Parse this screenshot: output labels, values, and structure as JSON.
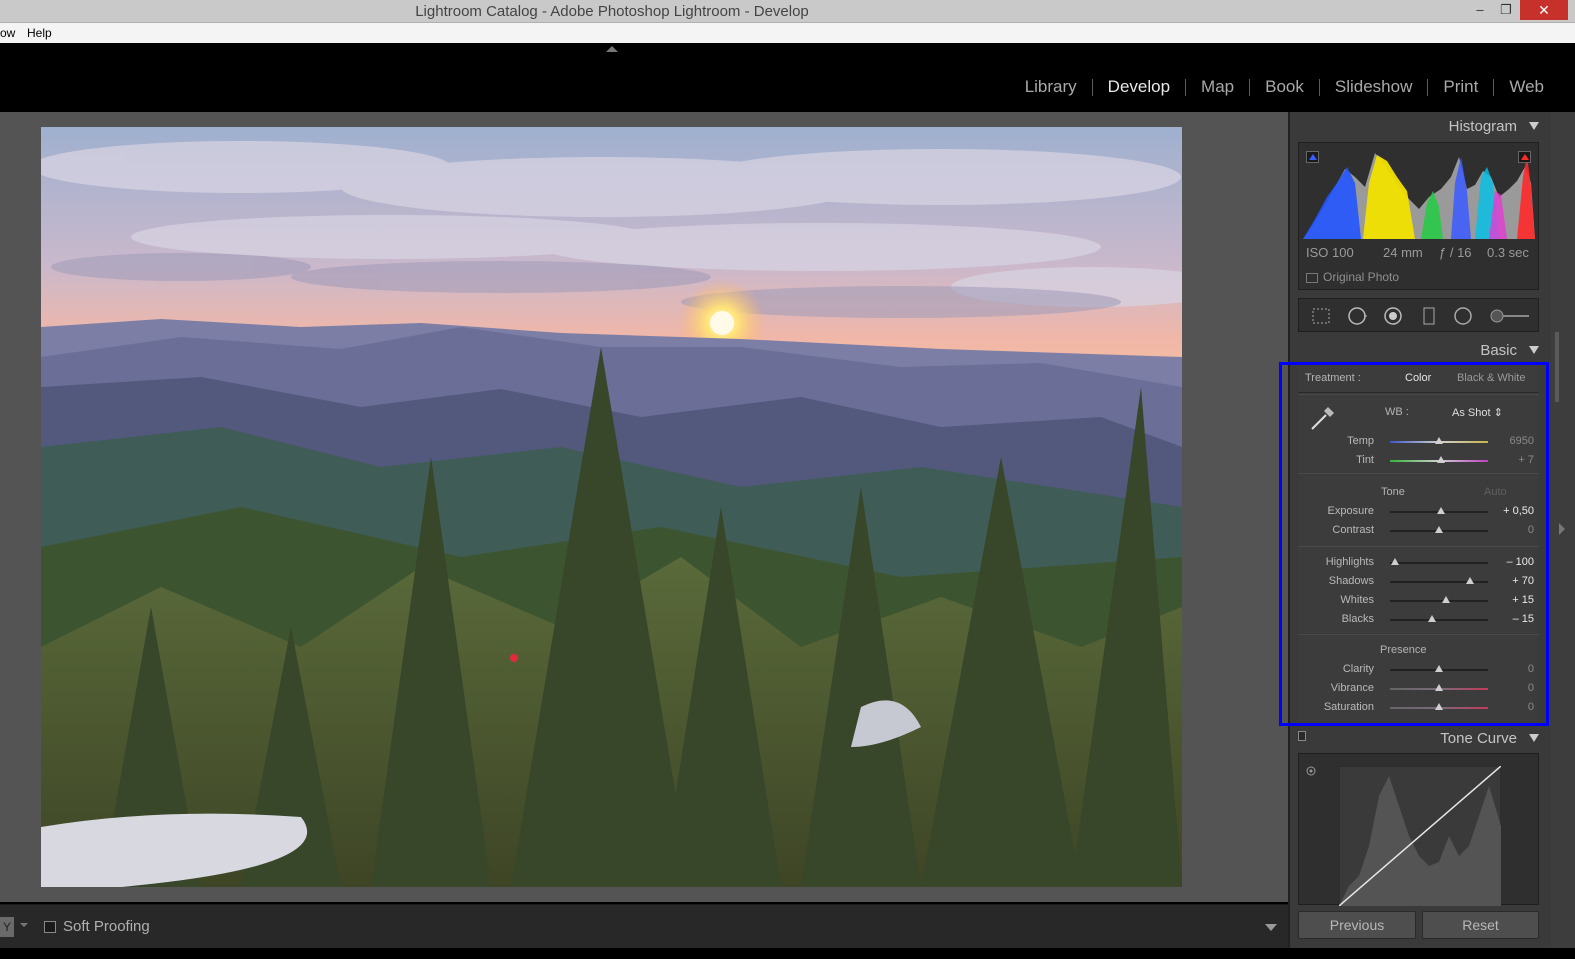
{
  "window": {
    "title": "Lightroom Catalog - Adobe Photoshop Lightroom - Develop",
    "min": "–",
    "max": "❐",
    "close": "✕"
  },
  "menu": {
    "items": [
      "ow",
      "Help"
    ]
  },
  "modules": [
    "Library",
    "Develop",
    "Map",
    "Book",
    "Slideshow",
    "Print",
    "Web"
  ],
  "active_module": "Develop",
  "toolbar": {
    "view_mode": "Y",
    "soft_proofing": "Soft Proofing"
  },
  "histogram": {
    "title": "Histogram",
    "iso": "ISO 100",
    "focal": "24 mm",
    "aperture": "ƒ / 16",
    "shutter": "0.3 sec",
    "original_photo": "Original Photo"
  },
  "basic": {
    "title": "Basic",
    "treatment_label": "Treatment :",
    "treatment_color": "Color",
    "treatment_bw": "Black & White",
    "wb_label": "WB :",
    "wb_value": "As Shot ⇕",
    "tone_label": "Tone",
    "auto_label": "Auto",
    "presence_label": "Presence",
    "sliders": [
      {
        "name": "Temp",
        "value": "6950",
        "pos": 0.5
      },
      {
        "name": "Tint",
        "value": "+ 7",
        "pos": 0.52
      },
      {
        "name": "Exposure",
        "value": "+ 0,50",
        "pos": 0.52
      },
      {
        "name": "Contrast",
        "value": "0",
        "pos": 0.5
      },
      {
        "name": "Highlights",
        "value": "– 100",
        "pos": 0.05
      },
      {
        "name": "Shadows",
        "value": "+ 70",
        "pos": 0.82
      },
      {
        "name": "Whites",
        "value": "+ 15",
        "pos": 0.57
      },
      {
        "name": "Blacks",
        "value": "– 15",
        "pos": 0.43
      },
      {
        "name": "Clarity",
        "value": "0",
        "pos": 0.5
      },
      {
        "name": "Vibrance",
        "value": "0",
        "pos": 0.5
      },
      {
        "name": "Saturation",
        "value": "0",
        "pos": 0.5
      }
    ]
  },
  "tone_curve": {
    "title": "Tone Curve"
  },
  "buttons": {
    "previous": "Previous",
    "reset": "Reset"
  },
  "colors": {
    "highlight_box": "#0000ff",
    "active_module": "#e8e8e8"
  }
}
